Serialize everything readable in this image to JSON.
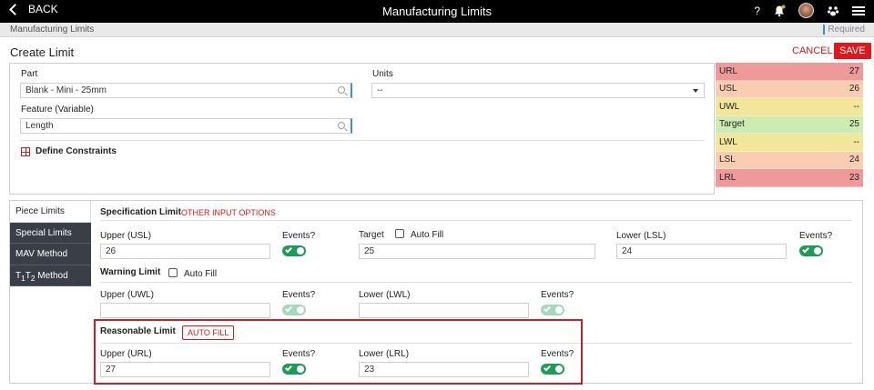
{
  "header": {
    "back_label": "BACK",
    "title": "Manufacturing Limits",
    "help_icon": "?"
  },
  "crumb": {
    "path": "Manufacturing Limits",
    "required": "Required"
  },
  "create": {
    "title": "Create Limit",
    "cancel": "CANCEL",
    "save": "SAVE"
  },
  "form": {
    "part_label": "Part",
    "part_value": "Blank - Mini - 25mm",
    "units_label": "Units",
    "units_value": "--",
    "feature_label": "Feature (Variable)",
    "feature_value": "Length",
    "define_constraints": "Define Constraints"
  },
  "limits_table": [
    {
      "name": "URL",
      "value": "27",
      "color": "#ee9a9a"
    },
    {
      "name": "USL",
      "value": "26",
      "color": "#f8cdb2"
    },
    {
      "name": "UWL",
      "value": "--",
      "color": "#f2e69a"
    },
    {
      "name": "Target",
      "value": "25",
      "color": "#cdebb3"
    },
    {
      "name": "LWL",
      "value": "--",
      "color": "#f2e69a"
    },
    {
      "name": "LSL",
      "value": "24",
      "color": "#f8cdb2"
    },
    {
      "name": "LRL",
      "value": "23",
      "color": "#ee9a9a"
    }
  ],
  "side_menu": {
    "piece": "Piece Limits",
    "special": "Special Limits",
    "mav": "MAV Method",
    "t1t2": {
      "t": "T",
      "s1": "1",
      "s2": "2",
      "rest": " Method"
    }
  },
  "spec": {
    "title": "Specification Limit",
    "other_options": "OTHER INPUT OPTIONS",
    "upper_label": "Upper (USL)",
    "upper_value": "26",
    "events_label": "Events?",
    "target_label": "Target",
    "auto_fill": "Auto Fill",
    "target_value": "25",
    "lower_label": "Lower (LSL)",
    "lower_value": "24",
    "events2_label": "Events?"
  },
  "warning": {
    "title": "Warning Limit",
    "auto_fill": "Auto Fill",
    "upper_label": "Upper (UWL)",
    "upper_value": "",
    "events_label": "Events?",
    "lower_label": "Lower (LWL)",
    "lower_value": "",
    "events2_label": "Events?"
  },
  "reasonable": {
    "title": "Reasonable Limit",
    "auto_fill_button": "AUTO FILL",
    "upper_label": "Upper (URL)",
    "upper_value": "27",
    "events_label": "Events?",
    "lower_label": "Lower (LRL)",
    "lower_value": "23",
    "events2_label": "Events?"
  }
}
